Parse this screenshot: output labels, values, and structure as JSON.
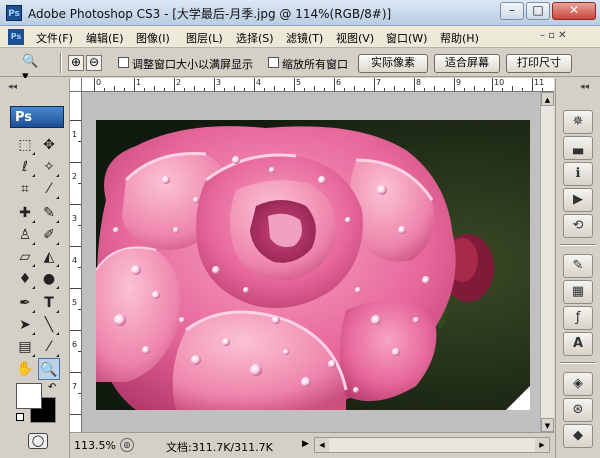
{
  "window": {
    "app_icon": "Ps",
    "title": "Adobe Photoshop CS3 - [大学最后-月季.jpg @ 114%(RGB/8#)]",
    "min_label": "–",
    "max_label": "□",
    "close_label": "✕"
  },
  "menu": {
    "logo": "Ps",
    "items": [
      "文件(F)",
      "编辑(E)",
      "图像(I)",
      "图层(L)",
      "选择(S)",
      "滤镜(T)",
      "视图(V)",
      "窗口(W)",
      "帮助(H)"
    ],
    "doc_controls": "– ▫ ✕"
  },
  "options": {
    "tool_icon": "zoom-icon",
    "zoom_in": "⊕",
    "zoom_out": "⊖",
    "resize_window_label": "调整窗口大小以满屏显示",
    "zoom_all_label": "缩放所有窗口",
    "actual_pixels": "实际像素",
    "fit_screen": "适合屏幕",
    "print_size": "打印尺寸"
  },
  "toolbox": {
    "collapse": "◂◂",
    "logo": "Ps",
    "tools": [
      "marquee-icon",
      "move-icon",
      "lasso-icon",
      "magic-wand-icon",
      "crop-icon",
      "slice-icon",
      "healing-icon",
      "brush-icon",
      "stamp-icon",
      "history-brush-icon",
      "eraser-icon",
      "bucket-icon",
      "blur-icon",
      "dodge-icon",
      "pen-icon",
      "type-icon",
      "path-select-icon",
      "line-icon",
      "notes-icon",
      "eyedropper-icon",
      "hand-icon",
      "zoom-tool-icon"
    ],
    "foreground_color": "#ffffff",
    "background_color": "#000000"
  },
  "ruler": {
    "top_labels": [
      "0",
      "1",
      "2",
      "3",
      "4",
      "5",
      "6",
      "7",
      "8",
      "9",
      "10",
      "11"
    ],
    "left_labels": [
      "1",
      "2",
      "3",
      "4",
      "5",
      "6",
      "7"
    ]
  },
  "status": {
    "zoom": "113.5%",
    "doc_size": "文档:311.7K/311.7K",
    "arrow": "▶"
  },
  "palette": {
    "collapse": "◂◂",
    "buttons": [
      "navigator-icon",
      "histogram-icon",
      "info-icon",
      "actions-icon",
      "history-icon",
      "brushes-icon",
      "swatches-icon",
      "styles-icon",
      "character-icon",
      "layers-icon",
      "channels-icon",
      "paths-icon"
    ]
  }
}
